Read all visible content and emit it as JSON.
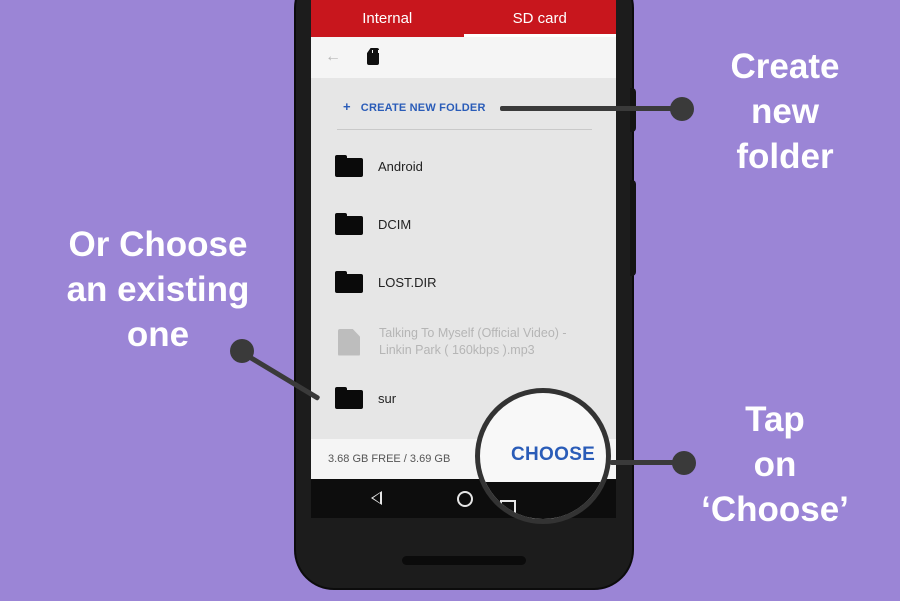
{
  "tabs": {
    "internal": "Internal",
    "sd_card": "SD card"
  },
  "toolbar": {
    "back_icon": "arrow-left-icon",
    "sd_icon": "sd-card-icon"
  },
  "create_folder": {
    "plus": "+",
    "label": "CREATE NEW FOLDER"
  },
  "items": [
    {
      "type": "folder",
      "name": "Android"
    },
    {
      "type": "folder",
      "name": "DCIM"
    },
    {
      "type": "folder",
      "name": "LOST.DIR"
    },
    {
      "type": "file",
      "name_line1": "Talking To Myself (Official Video) -",
      "name_line2": "Linkin Park ( 160kbps ).mp3"
    },
    {
      "type": "folder",
      "name": "sur"
    }
  ],
  "footer": {
    "storage": "3.68 GB FREE / 3.69 GB",
    "choose": "CHOOSE"
  },
  "callouts": {
    "create": [
      "Create",
      "new",
      "folder"
    ],
    "existing": [
      "Or Choose",
      "an existing",
      "one"
    ],
    "tap": [
      "Tap",
      "on",
      "‘Choose’"
    ]
  },
  "colors": {
    "background": "#9b85d6",
    "tab_bar": "#c8161d",
    "accent": "#2a5cb8"
  }
}
